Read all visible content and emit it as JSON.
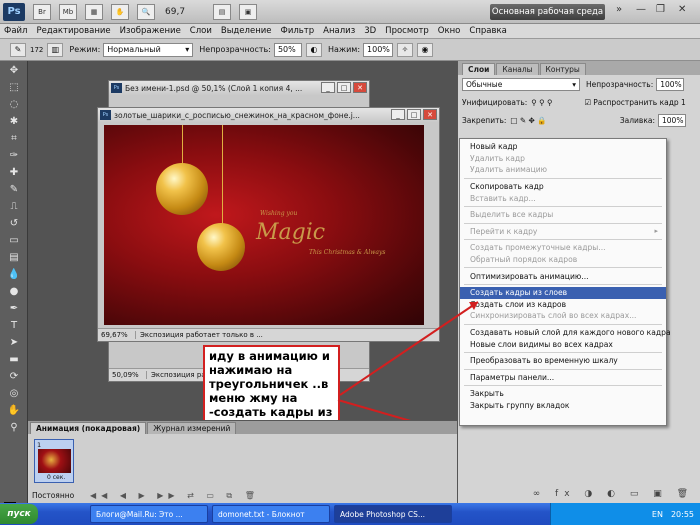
{
  "app": {
    "logo": "Ps",
    "zoom": "69,7",
    "workspace": "Основная рабочая среда"
  },
  "menu": [
    "Файл",
    "Редактирование",
    "Изображение",
    "Слои",
    "Выделение",
    "Фильтр",
    "Анализ",
    "3D",
    "Просмотр",
    "Окно",
    "Справка"
  ],
  "options": {
    "brush_size": "172",
    "mode_label": "Режим:",
    "mode_value": "Нормальный",
    "opacity_label": "Непрозрачность:",
    "opacity_value": "50%",
    "pressure_label": "Нажим:",
    "pressure_value": "100%"
  },
  "doc_back": {
    "title": "Без имени-1.psd @ 50,1% (Слой 1 копия 4, ...",
    "zoom": "50,09%",
    "status": "Экспозиция работает только в ..."
  },
  "doc_front": {
    "title": "золотые_шарики_с_росписью_снежинок_на_красном_фоне.j...",
    "zoom": "69,67%",
    "status": "Экспозиция работает только в ...",
    "art_text_1": "Magic",
    "art_text_2": "Wishing you",
    "art_text_3": "This Christmas & Always"
  },
  "layers_panel": {
    "tabs": [
      "Слои",
      "Каналы",
      "Контуры"
    ],
    "blend_mode": "Обычные",
    "opacity_label": "Непрозрачность:",
    "opacity_value": "100%",
    "unify_label": "Унифицировать:",
    "propagate_label": "Распространить кадр 1",
    "lock_label": "Закрепить:",
    "fill_label": "Заливка:",
    "fill_value": "100%"
  },
  "context_menu": [
    {
      "label": "Новый кадр",
      "disabled": false
    },
    {
      "label": "Удалить кадр",
      "disabled": true
    },
    {
      "label": "Удалить анимацию",
      "disabled": true
    },
    {
      "sep": true
    },
    {
      "label": "Скопировать кадр",
      "disabled": false
    },
    {
      "label": "Вставить кадр...",
      "disabled": true
    },
    {
      "sep": true
    },
    {
      "label": "Выделить все кадры",
      "disabled": true
    },
    {
      "sep": true
    },
    {
      "label": "Перейти к кадру",
      "disabled": true,
      "submenu": true
    },
    {
      "sep": true
    },
    {
      "label": "Создать промежуточные кадры...",
      "disabled": true
    },
    {
      "label": "Обратный порядок кадров",
      "disabled": true
    },
    {
      "sep": true
    },
    {
      "label": "Оптимизировать анимацию...",
      "disabled": false
    },
    {
      "sep": true
    },
    {
      "label": "Создать кадры из слоев",
      "disabled": false,
      "selected": true
    },
    {
      "label": "Создать слои из кадров",
      "disabled": false
    },
    {
      "label": "Синхронизировать слой во всех кадрах...",
      "disabled": true
    },
    {
      "sep": true
    },
    {
      "label": "Создавать новый слой для каждого нового кадра",
      "disabled": false
    },
    {
      "label": "Новые слои видимы во всех кадрах",
      "disabled": false
    },
    {
      "sep": true
    },
    {
      "label": "Преобразовать во временную шкалу",
      "disabled": false
    },
    {
      "sep": true
    },
    {
      "label": "Параметры панели...",
      "disabled": false
    },
    {
      "sep": true
    },
    {
      "label": "Закрыть",
      "disabled": false
    },
    {
      "label": "Закрыть группу вкладок",
      "disabled": false
    }
  ],
  "annotation": "иду в анимацию и нажимаю на треугольничек ..в меню жму на -создать кадры из слоёв",
  "animation_panel": {
    "tabs": [
      "Анимация (покадровая)",
      "Журнал измерений"
    ],
    "frame_number": "1",
    "frame_time": "0 сек.",
    "loop": "Постоянно"
  },
  "taskbar": {
    "start": "пуск",
    "tasks": [
      "Блоги@Mail.Ru: Это ...",
      "domonet.txt - Блокнот",
      "Adobe Photoshop CS..."
    ],
    "clock": "20:55",
    "lang": "EN"
  },
  "colors": {
    "accent": "#3a60b0",
    "annotation_border": "#d21f1f"
  }
}
